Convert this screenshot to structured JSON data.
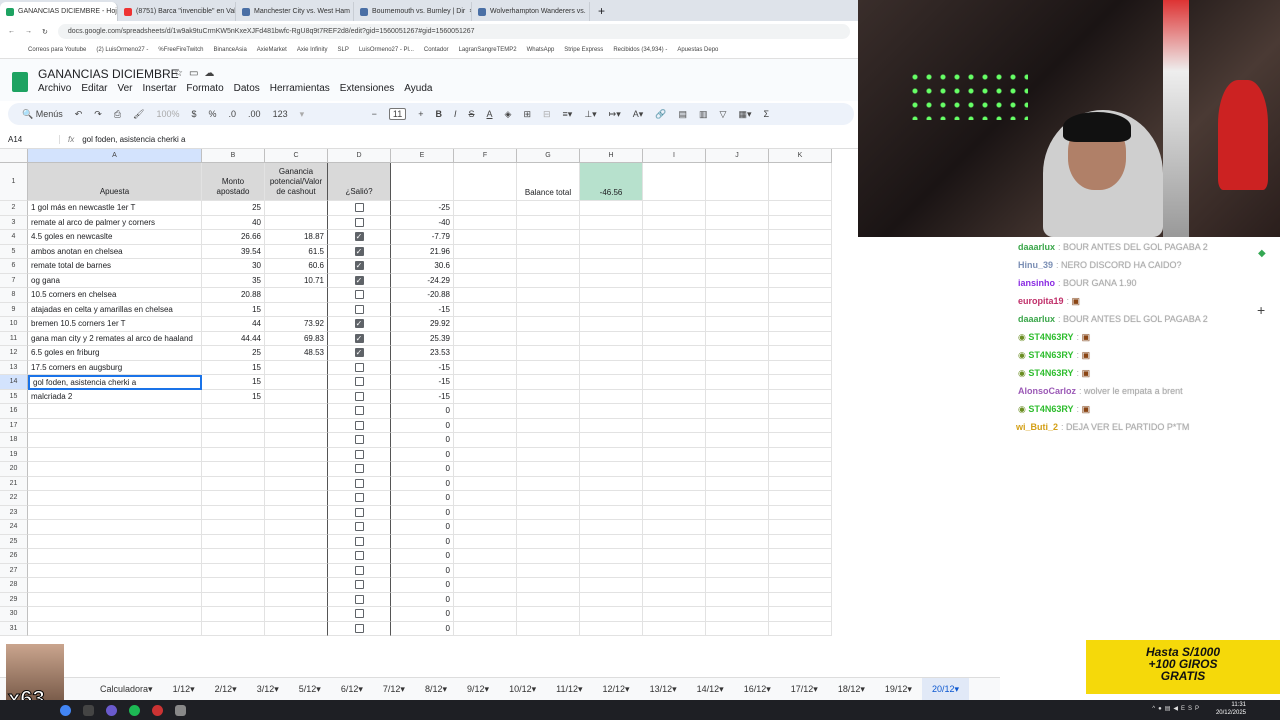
{
  "browser": {
    "tabs": [
      {
        "title": "GANANCIAS DICIEMBRE - Hoja de cálculo",
        "active": true,
        "color": "#1ea362"
      },
      {
        "title": "(8751) Barca \"invencible\" en Valencia",
        "active": false,
        "color": "#e33"
      },
      {
        "title": "Manchester City vs. West Ham",
        "active": false,
        "color": "#4a6fa5"
      },
      {
        "title": "Bournemouth vs. Burnley | Dir",
        "active": false,
        "color": "#4a6fa5"
      },
      {
        "title": "Wolverhampton Wanderers vs.",
        "active": false,
        "color": "#4a6fa5"
      }
    ],
    "url": "docs.google.com/spreadsheets/d/1w9ak9tuCrmKW5nKxeXJFd481bwfc-RgU8q9t7REF2d8/edit?gid=1560051267#gid=1560051267",
    "bookmarks": [
      "Correos para Youtube",
      "(2) LuisOrmeno27 -",
      "%FreeFireTwitch",
      "BinanceAsia",
      "AxieMarket",
      "Axie Infinity",
      "SLP",
      "LuisOrmeno27 - Pl...",
      "Contador",
      "LagranSangreTEMP2",
      "WhatsApp",
      "Stripe Express",
      "Recibidos (34,934) -",
      "Apuestas Depo"
    ]
  },
  "sheets": {
    "doc_title": "GANANCIAS DICIEMBRE",
    "menu": [
      "Archivo",
      "Editar",
      "Ver",
      "Insertar",
      "Formato",
      "Datos",
      "Herramientas",
      "Extensiones",
      "Ayuda"
    ],
    "toolbar": {
      "search": "Menús",
      "zoom": "100%",
      "currency": "$",
      "percent": "%",
      "dec_less": ".0",
      "dec_more": ".00",
      "number_format": "123",
      "font_size": "11"
    },
    "cell_ref": "A14",
    "formula": "gol foden, asistencia cherki a",
    "columns": [
      "A",
      "B",
      "C",
      "D",
      "E",
      "F",
      "G",
      "H",
      "I",
      "J",
      "K"
    ],
    "headers": {
      "a": "Apuesta",
      "b": "Monto apostado",
      "c": "Ganancia potencial/Valor de cashout",
      "d": "¿Salió?",
      "g": "Balance total",
      "h": "-46.56"
    },
    "rows": [
      {
        "n": "2",
        "a": "1 gol más en newcastle 1er T",
        "b": "25",
        "c": "",
        "d": false,
        "e": "-25"
      },
      {
        "n": "3",
        "a": "remate al arco de palmer y corners",
        "b": "40",
        "c": "",
        "d": false,
        "e": "-40"
      },
      {
        "n": "4",
        "a": "4.5 goles en newcaslte",
        "b": "26.66",
        "c": "18.87",
        "d": true,
        "e": "-7.79"
      },
      {
        "n": "5",
        "a": "ambos anotan en chelsea",
        "b": "39.54",
        "c": "61.5",
        "d": true,
        "e": "21.96"
      },
      {
        "n": "6",
        "a": "remate total de barnes",
        "b": "30",
        "c": "60.6",
        "d": true,
        "e": "30.6"
      },
      {
        "n": "7",
        "a": "og gana",
        "b": "35",
        "c": "10.71",
        "d": true,
        "e": "-24.29"
      },
      {
        "n": "8",
        "a": "10.5 corners en chelsea",
        "b": "20.88",
        "c": "",
        "d": false,
        "e": "-20.88"
      },
      {
        "n": "9",
        "a": "atajadas en celta y amarillas en chelsea",
        "b": "15",
        "c": "",
        "d": false,
        "e": "-15"
      },
      {
        "n": "10",
        "a": "bremen 10.5 corners 1er T",
        "b": "44",
        "c": "73.92",
        "d": true,
        "e": "29.92"
      },
      {
        "n": "11",
        "a": "gana man city y 2 remates al arco de haaland",
        "b": "44.44",
        "c": "69.83",
        "d": true,
        "e": "25.39"
      },
      {
        "n": "12",
        "a": "6.5 goles en friburg",
        "b": "25",
        "c": "48.53",
        "d": true,
        "e": "23.53"
      },
      {
        "n": "13",
        "a": "17.5 corners en augsburg",
        "b": "15",
        "c": "",
        "d": false,
        "e": "-15"
      },
      {
        "n": "14",
        "a": "gol foden, asistencia cherki a",
        "b": "15",
        "c": "",
        "d": false,
        "e": "-15"
      },
      {
        "n": "15",
        "a": "malcriada 2",
        "b": "15",
        "c": "",
        "d": false,
        "e": "-15"
      },
      {
        "n": "16",
        "a": "",
        "b": "",
        "c": "",
        "d": false,
        "e": "0"
      },
      {
        "n": "17",
        "a": "",
        "b": "",
        "c": "",
        "d": false,
        "e": "0"
      },
      {
        "n": "18",
        "a": "",
        "b": "",
        "c": "",
        "d": false,
        "e": "0"
      },
      {
        "n": "19",
        "a": "",
        "b": "",
        "c": "",
        "d": false,
        "e": "0"
      },
      {
        "n": "20",
        "a": "",
        "b": "",
        "c": "",
        "d": false,
        "e": "0"
      },
      {
        "n": "21",
        "a": "",
        "b": "",
        "c": "",
        "d": false,
        "e": "0"
      },
      {
        "n": "22",
        "a": "",
        "b": "",
        "c": "",
        "d": false,
        "e": "0"
      },
      {
        "n": "23",
        "a": "",
        "b": "",
        "c": "",
        "d": false,
        "e": "0"
      },
      {
        "n": "24",
        "a": "",
        "b": "",
        "c": "",
        "d": false,
        "e": "0"
      },
      {
        "n": "25",
        "a": "",
        "b": "",
        "c": "",
        "d": false,
        "e": "0"
      },
      {
        "n": "26",
        "a": "",
        "b": "",
        "c": "",
        "d": false,
        "e": "0"
      },
      {
        "n": "27",
        "a": "",
        "b": "",
        "c": "",
        "d": false,
        "e": "0"
      },
      {
        "n": "28",
        "a": "",
        "b": "",
        "c": "",
        "d": false,
        "e": "0"
      },
      {
        "n": "29",
        "a": "",
        "b": "",
        "c": "",
        "d": false,
        "e": "0"
      },
      {
        "n": "30",
        "a": "",
        "b": "",
        "c": "",
        "d": false,
        "e": "0"
      },
      {
        "n": "31",
        "a": "",
        "b": "",
        "c": "",
        "d": false,
        "e": "0"
      }
    ],
    "sheet_tabs": [
      "Calculadora",
      "1/12",
      "2/12",
      "3/12",
      "5/12",
      "6/12",
      "7/12",
      "8/12",
      "9/12",
      "10/12",
      "11/12",
      "12/12",
      "13/12",
      "14/12",
      "16/12",
      "17/12",
      "18/12",
      "19/12",
      "20/12"
    ],
    "active_sheet": "20/12"
  },
  "chat": [
    {
      "name": "daaarlux",
      "color": "#3aa64a",
      "msg": "BOUR ANTES DEL GOL PAGABA 2",
      "badge": false
    },
    {
      "name": "Hinu_39",
      "color": "#7b8fb5",
      "msg": "NERO DISCORD HA CAIDO?",
      "badge": false
    },
    {
      "name": "iansinho",
      "color": "#8a2be2",
      "msg": "BOUR GANA 1.90",
      "badge": false
    },
    {
      "name": "europita19",
      "color": "#c0306a",
      "msg": "▣",
      "badge": false
    },
    {
      "name": "daaarlux",
      "color": "#3aa64a",
      "msg": "BOUR ANTES DEL GOL PAGABA 2",
      "badge": false
    },
    {
      "name": "ST4N63RY",
      "color": "#2ebd2e",
      "msg": "▣",
      "badge": true
    },
    {
      "name": "ST4N63RY",
      "color": "#2ebd2e",
      "msg": "▣",
      "badge": true
    },
    {
      "name": "ST4N63RY",
      "color": "#2ebd2e",
      "msg": "▣",
      "badge": true
    },
    {
      "name": "AlonsoCarloz",
      "color": "#9b59b6",
      "msg": "wolver le empata a brent",
      "badge": false
    },
    {
      "name": "ST4N63RY",
      "color": "#2ebd2e",
      "msg": "▣",
      "badge": true
    },
    {
      "name": "wi_Buti_2",
      "color": "#d4a017",
      "msg": "DEJA VER EL PARTIDO P*TM",
      "badge": false
    }
  ],
  "promo": {
    "line1": "Hasta S/1000",
    "line2": "+100 GIROS",
    "line3": "GRATIS"
  },
  "emote_count": "x63",
  "system": {
    "time": "11:31",
    "date": "20/12/2025",
    "lang": "ESP"
  }
}
